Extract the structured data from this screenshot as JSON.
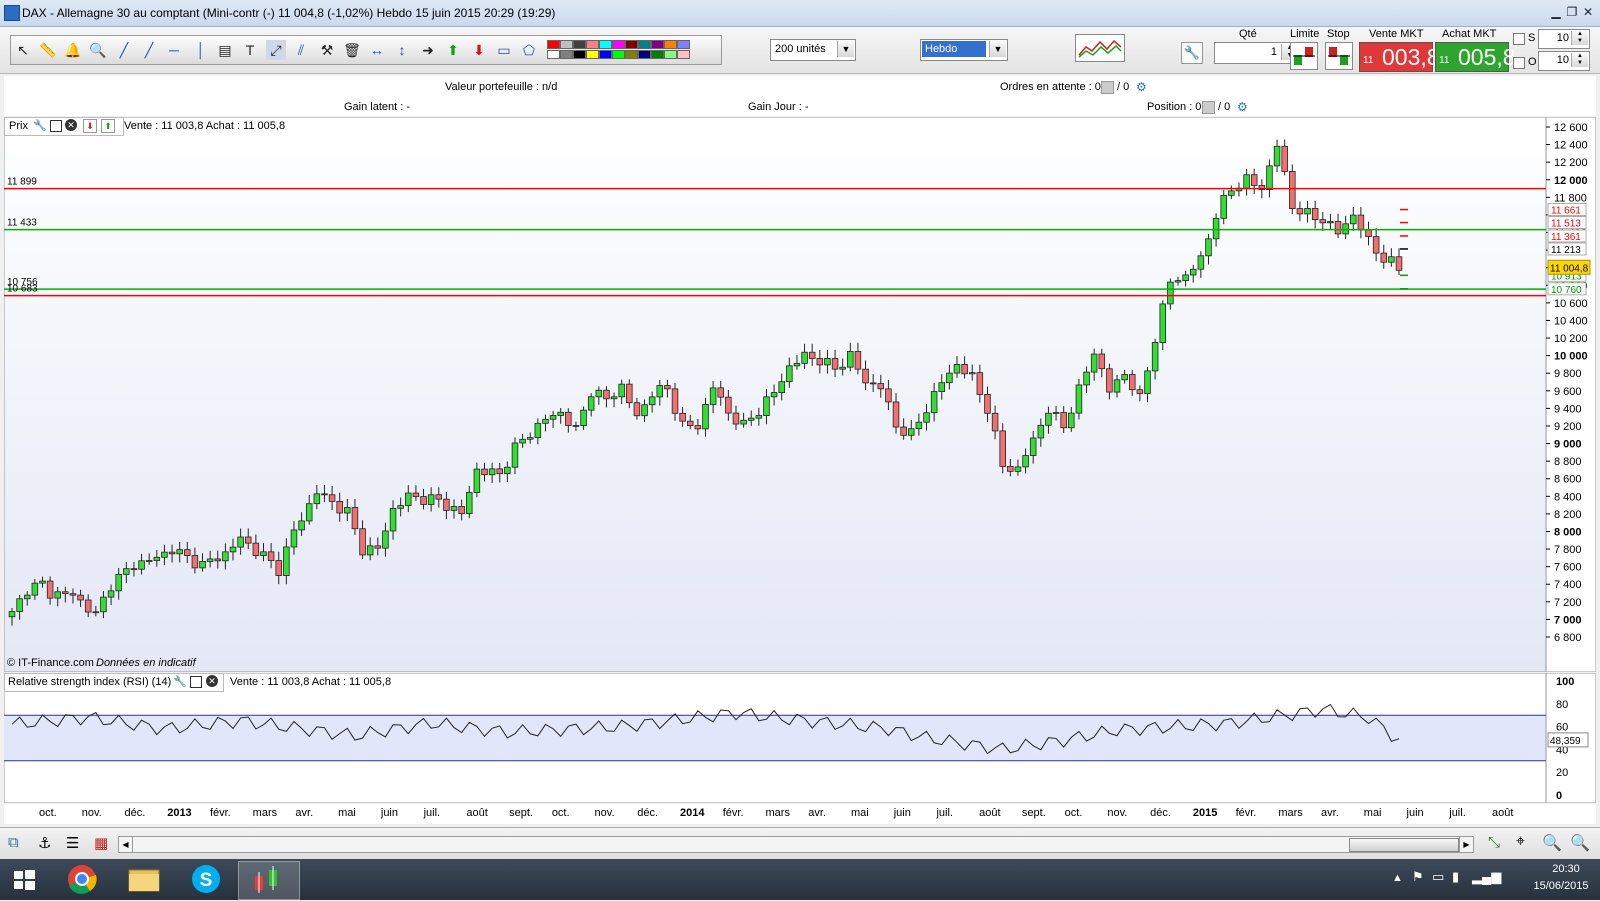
{
  "window": {
    "title": "DAX - Allemagne 30 au comptant (Mini-contr (-)     11 004,8 (-1,02%)     Hebdo   15 juin 2015 20:29 (19:29)",
    "minimize": "▁",
    "restore": "❐",
    "close": "✕"
  },
  "toolbar": {
    "units_value": "200 unités",
    "period_value": "Hebdo",
    "swatch_colors": [
      "#ff0000",
      "#ffffff",
      "#c0c0c0",
      "#808080",
      "#404040",
      "#000000",
      "#ff8080",
      "#ffff00",
      "#00ffff",
      "#0000ff",
      "#ff00ff",
      "#00ff00",
      "#800000",
      "#808000",
      "#008080",
      "#000080",
      "#800080",
      "#008000",
      "#ff8000",
      "#80ff80",
      "#8080ff",
      "#ffc0c0"
    ]
  },
  "order": {
    "qty_label": "Qté",
    "qty_value": "1",
    "limit_label": "Limite",
    "stop_label": "Stop",
    "sell_label": "Vente MKT",
    "buy_label": "Achat MKT",
    "sell_small": "11",
    "sell_big": "003,8",
    "buy_small": "11",
    "buy_big": "005,8",
    "s_label": "S",
    "o_label": "O",
    "s_value": "10",
    "o_value": "10"
  },
  "info": {
    "portfolio": "Valeur portefeuille : n/d",
    "orders": "Ordres en attente : 0",
    "orders2": "/  0",
    "gain_latent": "Gain latent : -",
    "gain_jour": "Gain Jour : -",
    "position": "Position : 0",
    "position2": "/  0"
  },
  "price_panel": {
    "title": "Prix",
    "quote": "Vente : 11 003,8 Achat : 11 005,8",
    "credit": "© IT-Finance.com",
    "credit_note": "Données en indicatif",
    "hlines": [
      {
        "label": "11 899",
        "value": 11899,
        "color": "#ff0000"
      },
      {
        "label": "11 433",
        "value": 11433,
        "color": "#00b000"
      },
      {
        "label": "10 756",
        "value": 10756,
        "color": "#00b000"
      },
      {
        "label": "10 683",
        "value": 10683,
        "color": "#ff0000"
      }
    ],
    "right_labels": [
      {
        "text": "11 661",
        "value": 11661,
        "color": "#ff0000"
      },
      {
        "text": "11 513",
        "value": 11513,
        "color": "#ff0000"
      },
      {
        "text": "11 361",
        "value": 11361,
        "color": "#ff0000"
      },
      {
        "text": "11 213",
        "value": 11213,
        "color": "#000000"
      },
      {
        "text": "10 913",
        "value": 10913,
        "color": "#00a000"
      },
      {
        "text": "10 760",
        "value": 10760,
        "color": "#00a000"
      }
    ],
    "current_label": "11 004,8"
  },
  "rsi_panel": {
    "title": "Relative strength index (RSI) (14)",
    "quote": "Vente : 11 003,8 Achat : 11 005,8",
    "value_label": "48,359",
    "ticks": [
      "100",
      "80",
      "60",
      "40",
      "20",
      "0"
    ]
  },
  "time_axis": {
    "labels": [
      "oct.",
      "nov.",
      "déc.",
      "2013",
      "févr.",
      "mars",
      "avr.",
      "mai",
      "juin",
      "juil.",
      "août",
      "sept.",
      "oct.",
      "nov.",
      "déc.",
      "2014",
      "févr.",
      "mars",
      "avr.",
      "mai",
      "juin",
      "juil.",
      "août",
      "sept.",
      "oct.",
      "nov.",
      "déc.",
      "2015",
      "févr.",
      "mars",
      "avr.",
      "mai",
      "juin",
      "juil.",
      "août"
    ],
    "bold": [
      "2013",
      "2014",
      "2015"
    ]
  },
  "taskbar": {
    "time": "20:30",
    "date": "15/06/2015"
  },
  "chart_data": {
    "type": "candlestick",
    "timeframe": "Hebdo",
    "y_axis": {
      "min": 6800,
      "max": 12600,
      "ticks": [
        12600,
        12400,
        12200,
        12000,
        11800,
        11600,
        11400,
        11200,
        11000,
        10800,
        10600,
        10400,
        10200,
        10000,
        9800,
        9600,
        9400,
        9200,
        9000,
        8800,
        8600,
        8400,
        8200,
        8000,
        7800,
        7600,
        7400,
        7200,
        7000,
        6800
      ],
      "tick_labels": [
        "12 600",
        "12 400",
        "12 200",
        "12 000",
        "11 800",
        "11 600",
        "11 400",
        "11 200",
        "11 000",
        "10 800",
        "10 600",
        "10 400",
        "10 200",
        "10 000",
        "9 800",
        "9 600",
        "9 400",
        "9 200",
        "9 000",
        "8 800",
        "8 600",
        "8 400",
        "8 200",
        "8 000",
        "7 800",
        "7 600",
        "7 400",
        "7 200",
        "7 000",
        "6 800"
      ],
      "bold_ticks": [
        "12 000",
        "10 000",
        "8 000",
        "7 000",
        "9 000",
        "11 000"
      ]
    },
    "anchors": [
      [
        0,
        7060
      ],
      [
        2,
        7350
      ],
      [
        4,
        7400
      ],
      [
        5,
        7300
      ],
      [
        8,
        7280
      ],
      [
        10,
        7130
      ],
      [
        11,
        7050
      ],
      [
        13,
        7400
      ],
      [
        16,
        7620
      ],
      [
        19,
        7700
      ],
      [
        21,
        7800
      ],
      [
        23,
        7700
      ],
      [
        25,
        7620
      ],
      [
        28,
        7750
      ],
      [
        30,
        7920
      ],
      [
        33,
        7720
      ],
      [
        35,
        7570
      ],
      [
        37,
        8000
      ],
      [
        40,
        8450
      ],
      [
        42,
        8330
      ],
      [
        44,
        8220
      ],
      [
        46,
        7800
      ],
      [
        48,
        7800
      ],
      [
        50,
        8250
      ],
      [
        52,
        8400
      ],
      [
        56,
        8350
      ],
      [
        59,
        8200
      ],
      [
        61,
        8700
      ],
      [
        64,
        8650
      ],
      [
        66,
        8950
      ],
      [
        68,
        9120
      ],
      [
        70,
        9280
      ],
      [
        72,
        9350
      ],
      [
        74,
        9150
      ],
      [
        76,
        9600
      ],
      [
        78,
        9500
      ],
      [
        80,
        9650
      ],
      [
        82,
        9300
      ],
      [
        84,
        9580
      ],
      [
        86,
        9620
      ],
      [
        88,
        9200
      ],
      [
        90,
        9200
      ],
      [
        92,
        9650
      ],
      [
        94,
        9350
      ],
      [
        96,
        9200
      ],
      [
        98,
        9380
      ],
      [
        100,
        9580
      ],
      [
        102,
        9870
      ],
      [
        104,
        10000
      ],
      [
        106,
        9950
      ],
      [
        108,
        9850
      ],
      [
        110,
        10000
      ],
      [
        112,
        9700
      ],
      [
        114,
        9650
      ],
      [
        116,
        9200
      ],
      [
        118,
        9100
      ],
      [
        120,
        9400
      ],
      [
        122,
        9700
      ],
      [
        124,
        9900
      ],
      [
        126,
        9750
      ],
      [
        128,
        9400
      ],
      [
        130,
        8750
      ],
      [
        132,
        8700
      ],
      [
        134,
        9050
      ],
      [
        136,
        9380
      ],
      [
        138,
        9200
      ],
      [
        140,
        9600
      ],
      [
        142,
        10050
      ],
      [
        144,
        9600
      ],
      [
        146,
        9800
      ],
      [
        148,
        9500
      ],
      [
        150,
        10200
      ],
      [
        152,
        10850
      ],
      [
        154,
        10900
      ],
      [
        156,
        11100
      ],
      [
        158,
        11600
      ],
      [
        160,
        11900
      ],
      [
        162,
        12000
      ],
      [
        164,
        11900
      ],
      [
        166,
        12400
      ],
      [
        168,
        11700
      ],
      [
        170,
        11600
      ],
      [
        172,
        11550
      ],
      [
        174,
        11400
      ],
      [
        176,
        11600
      ],
      [
        178,
        11300
      ],
      [
        180,
        11100
      ],
      [
        182,
        11000
      ]
    ],
    "bars_count": 183
  }
}
